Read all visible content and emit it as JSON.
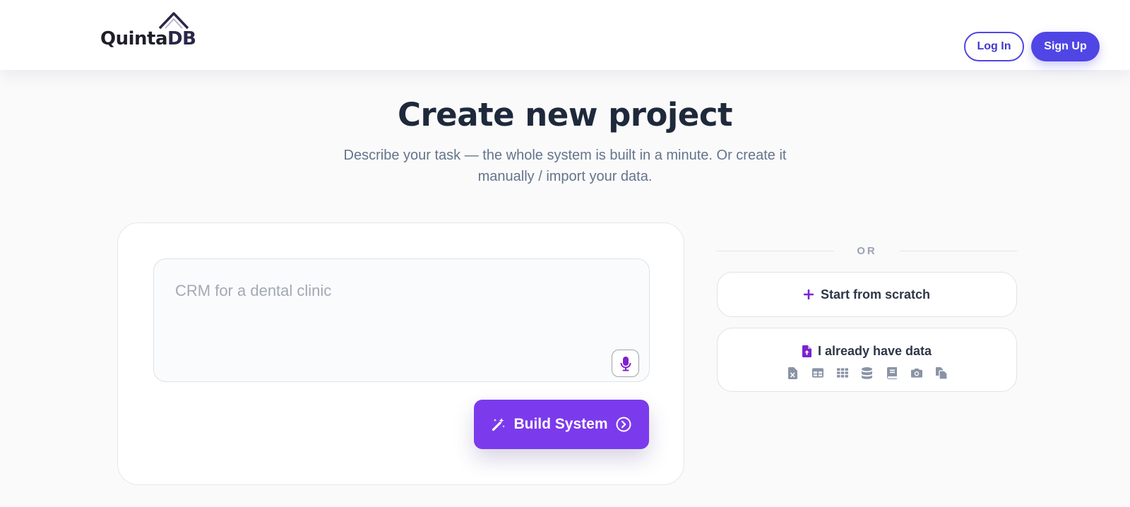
{
  "header": {
    "logo_text_main": "Quinta",
    "logo_text_accent": "DB",
    "login_label": "Log In",
    "signup_label": "Sign Up"
  },
  "hero": {
    "title": "Create new project",
    "subtitle_line1": "Describe your task — the whole system is built in a minute. Or create it",
    "subtitle_line2": "manually / import your data."
  },
  "prompt": {
    "placeholder": "CRM for a dental clinic",
    "value": "",
    "build_label": "Build System",
    "icons": [
      "microphone-icon",
      "magic-wand-icon",
      "chevron-right-circle-icon"
    ]
  },
  "options": {
    "or_text": "OR",
    "start_scratch_label": "Start from scratch",
    "have_data_label": "I already have data",
    "import_icons": [
      "excel-file-icon",
      "table-icon",
      "grid-icon",
      "database-icon",
      "book-icon",
      "camera-icon",
      "copy-files-icon"
    ]
  },
  "colors": {
    "primary": "#4f46e5",
    "build_button": "#7c3aed",
    "accent_icon": "#7e22ce",
    "title": "#1e293b",
    "muted_text": "#64748b",
    "icon_gray": "#8a94a6"
  }
}
